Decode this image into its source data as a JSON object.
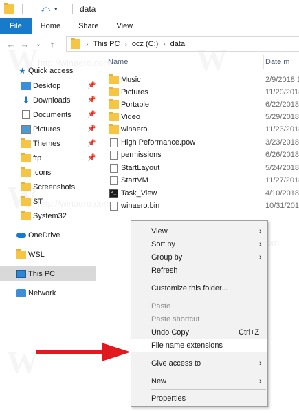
{
  "window": {
    "title": "data",
    "quick_access_toolbar": [
      "folder-icon",
      "properties-icon",
      "undo-icon",
      "customize-dropdown-icon"
    ]
  },
  "ribbon": {
    "tabs": [
      {
        "label": "File",
        "active": true
      },
      {
        "label": "Home"
      },
      {
        "label": "Share"
      },
      {
        "label": "View"
      }
    ]
  },
  "navigation": {
    "back": "←",
    "forward": "→",
    "recent": "⌄",
    "up": "↑",
    "breadcrumbs": [
      "This PC",
      "ocz (C:)",
      "data"
    ],
    "separator": "›"
  },
  "sidebar": {
    "items": [
      {
        "label": "Quick access",
        "icon": "star-icon",
        "pinned": false
      },
      {
        "label": "Desktop",
        "icon": "desktop-icon",
        "pinned": true
      },
      {
        "label": "Downloads",
        "icon": "downloads-icon",
        "pinned": true
      },
      {
        "label": "Documents",
        "icon": "documents-icon",
        "pinned": true
      },
      {
        "label": "Pictures",
        "icon": "pictures-icon",
        "pinned": true
      },
      {
        "label": "Themes",
        "icon": "folder-icon",
        "pinned": true
      },
      {
        "label": "ftp",
        "icon": "folder-icon",
        "pinned": true
      },
      {
        "label": "Icons",
        "icon": "folder-icon",
        "pinned": false
      },
      {
        "label": "Screenshots",
        "icon": "folder-icon",
        "pinned": false
      },
      {
        "label": "ST",
        "icon": "folder-icon",
        "pinned": false
      },
      {
        "label": "System32",
        "icon": "folder-icon",
        "pinned": false
      },
      {
        "label": "OneDrive",
        "icon": "onedrive-icon",
        "pinned": false
      },
      {
        "label": "WSL",
        "icon": "folder-icon",
        "pinned": false
      },
      {
        "label": "This PC",
        "icon": "this-pc-icon",
        "pinned": false,
        "selected": true
      },
      {
        "label": "Network",
        "icon": "network-icon",
        "pinned": false
      }
    ],
    "pin_glyph": "📌"
  },
  "file_list": {
    "columns": [
      "Name",
      "Date m"
    ],
    "files": [
      {
        "name": "Music",
        "type": "folder",
        "date": "2/9/2018 1"
      },
      {
        "name": "Pictures",
        "type": "folder",
        "date": "11/20/2018"
      },
      {
        "name": "Portable",
        "type": "folder",
        "date": "6/22/2018"
      },
      {
        "name": "Video",
        "type": "folder",
        "date": "5/29/2018"
      },
      {
        "name": "winaero",
        "type": "folder",
        "date": "11/23/2018"
      },
      {
        "name": "High Peformance.pow",
        "type": "file",
        "date": "3/23/2018"
      },
      {
        "name": "permissions",
        "type": "file",
        "date": "6/26/2018"
      },
      {
        "name": "StartLayout",
        "type": "file",
        "date": "5/24/2018"
      },
      {
        "name": "StartVM",
        "type": "file",
        "date": "11/27/2018"
      },
      {
        "name": "Task_View",
        "type": "cmd",
        "date": "4/10/2018"
      },
      {
        "name": "winaero.bin",
        "type": "file",
        "date": "10/31/2018"
      }
    ]
  },
  "context_menu": {
    "items": [
      {
        "label": "View",
        "submenu": true
      },
      {
        "label": "Sort by",
        "submenu": true
      },
      {
        "label": "Group by",
        "submenu": true
      },
      {
        "label": "Refresh"
      },
      {
        "separator": true
      },
      {
        "label": "Customize this folder..."
      },
      {
        "separator": true
      },
      {
        "label": "Paste",
        "disabled": true
      },
      {
        "label": "Paste shortcut",
        "disabled": true
      },
      {
        "label": "Undo Copy",
        "shortcut": "Ctrl+Z"
      },
      {
        "label": "File name extensions",
        "highlighted": true
      },
      {
        "separator": true
      },
      {
        "label": "Give access to",
        "submenu": true
      },
      {
        "separator": true
      },
      {
        "label": "New",
        "submenu": true
      },
      {
        "separator": true
      },
      {
        "label": "Properties"
      }
    ],
    "submenu_glyph": "›"
  },
  "watermark": {
    "letter": "W",
    "url": "http://winaero.com"
  },
  "colors": {
    "accent": "#1979ca",
    "folder": "#f7c544",
    "arrow": "#e4191f",
    "menu_bg": "#f2f2f2"
  }
}
